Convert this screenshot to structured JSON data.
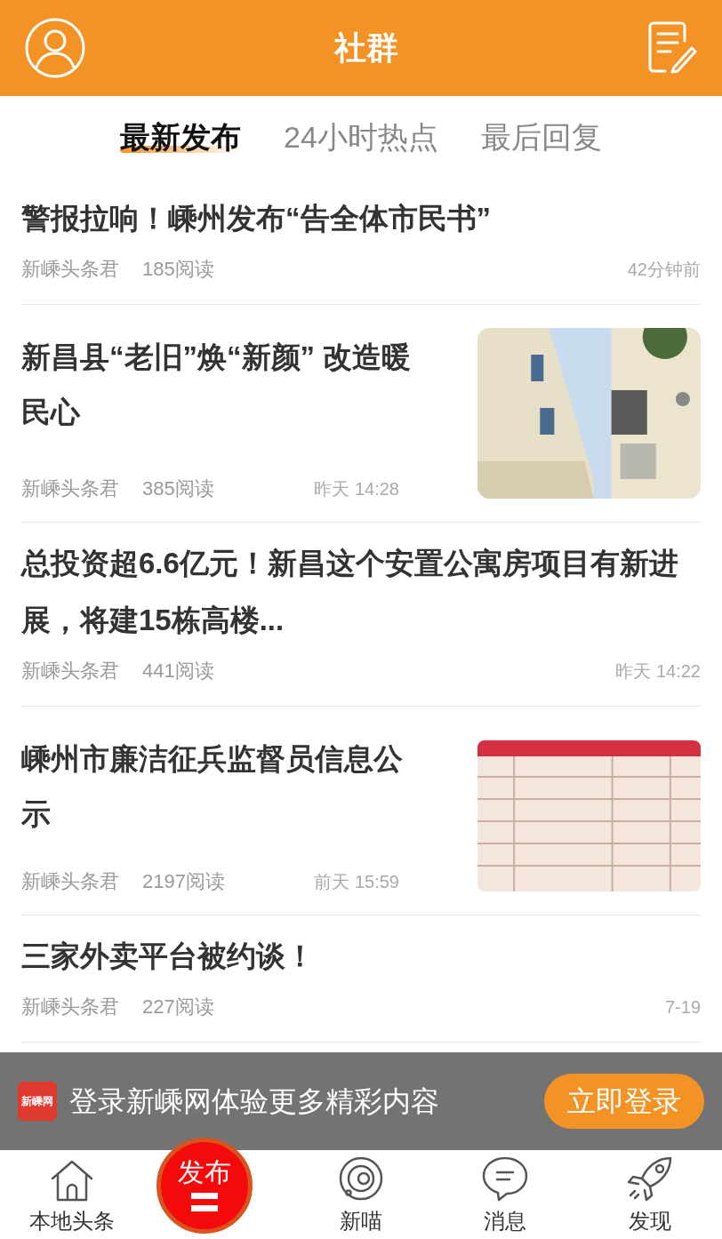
{
  "header": {
    "title": "社群"
  },
  "tabs": [
    {
      "label": "最新发布",
      "selected": true
    },
    {
      "label": "24小时热点",
      "selected": false
    },
    {
      "label": "最后回复",
      "selected": false
    }
  ],
  "articles": [
    {
      "kind": "text",
      "title": "警报拉响！嵊州发布“告全体市民书”",
      "author": "新嵊头条君",
      "reads": "185阅读",
      "time": "42分钟前"
    },
    {
      "title": "新昌县“老旧”焕“新颜” 改造暖民心",
      "author": "新嵊头条君",
      "reads": "385阅读",
      "time": "昨天 14:28"
    },
    {
      "kind": "text",
      "title": "总投资超6.6亿元！新昌这个安置公寓房项目有新进展，将建15栋高楼...",
      "author": "新嵊头条君",
      "reads": "441阅读",
      "time": "昨天 14:22"
    },
    {
      "title": "嵊州市廉洁征兵监督员信息公示",
      "author": "新嵊头条君",
      "reads": "2197阅读",
      "time": "前天 15:59"
    },
    {
      "kind": "text",
      "title": "三家外卖平台被约谈！",
      "author": "新嵊头条君",
      "reads": "227阅读",
      "time": "7-19"
    }
  ],
  "login_banner": {
    "logo": "新嵊网",
    "message": "登录新嵊网体验更多精彩内容",
    "button": "立即登录"
  },
  "nav": [
    {
      "kind": "home",
      "label": "本地头条"
    },
    {
      "kind": "publish",
      "label": "发布"
    },
    {
      "kind": "planet",
      "label": "新喵"
    },
    {
      "kind": "chat",
      "label": "消息"
    },
    {
      "kind": "rocket",
      "label": "发现"
    }
  ]
}
